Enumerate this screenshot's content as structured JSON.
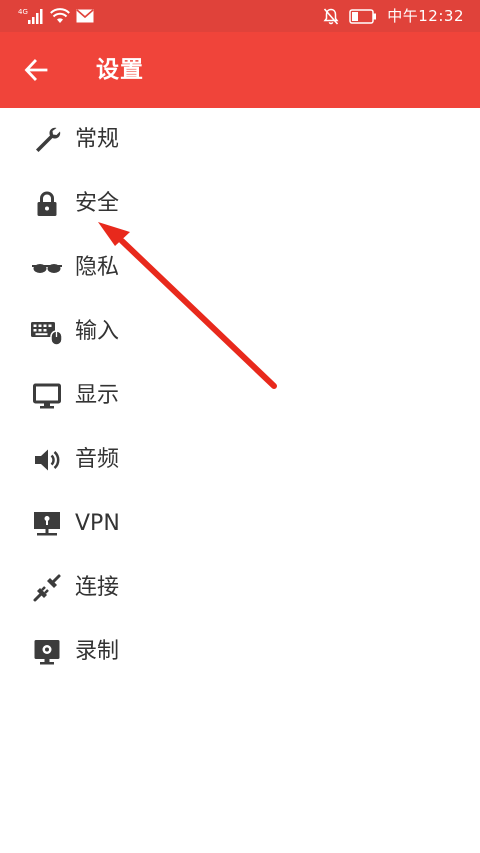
{
  "status_bar": {
    "network": "4G",
    "time": "中午12:32",
    "icons": [
      "signal-icon",
      "wifi-icon",
      "mail-icon",
      "mute-icon",
      "battery-icon"
    ]
  },
  "toolbar": {
    "back_icon": "back-arrow-icon",
    "title": "设置"
  },
  "menu": {
    "items": [
      {
        "label": "常规",
        "icon": "wrench-icon"
      },
      {
        "label": "安全",
        "icon": "lock-icon"
      },
      {
        "label": "隐私",
        "icon": "glasses-icon"
      },
      {
        "label": "输入",
        "icon": "keyboard-mouse-icon"
      },
      {
        "label": "显示",
        "icon": "monitor-icon"
      },
      {
        "label": "音频",
        "icon": "speaker-icon"
      },
      {
        "label": "VPN",
        "icon": "vpn-monitor-icon"
      },
      {
        "label": "连接",
        "icon": "plug-icon"
      },
      {
        "label": "录制",
        "icon": "record-screen-icon"
      }
    ]
  },
  "colors": {
    "status_bar": "#e0423a",
    "toolbar": "#f0443a",
    "menu_text": "#333333",
    "menu_icon": "#3c3c3c",
    "annotation_arrow": "#e8291c"
  }
}
